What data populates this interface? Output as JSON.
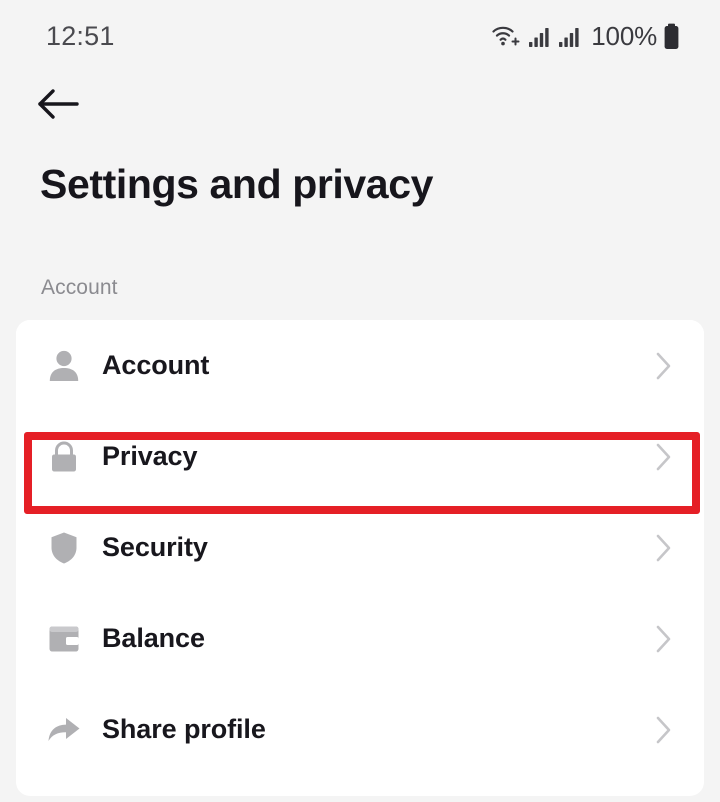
{
  "status_bar": {
    "time": "12:51",
    "battery_percent": "100%",
    "icons": [
      "wifi-calling-icon",
      "signal-bars-icon",
      "signal-bars-icon",
      "battery-icon"
    ]
  },
  "navigation": {
    "back_label": "Back",
    "back_icon": "arrow-left-icon"
  },
  "header": {
    "title": "Settings and privacy"
  },
  "sections": [
    {
      "label": "Account",
      "items": [
        {
          "label": "Account",
          "icon": "person-icon",
          "chevron": "chevron-right-icon",
          "highlighted": false
        },
        {
          "label": "Privacy",
          "icon": "lock-icon",
          "chevron": "chevron-right-icon",
          "highlighted": true
        },
        {
          "label": "Security",
          "icon": "shield-icon",
          "chevron": "chevron-right-icon",
          "highlighted": false
        },
        {
          "label": "Balance",
          "icon": "wallet-icon",
          "chevron": "chevron-right-icon",
          "highlighted": false
        },
        {
          "label": "Share profile",
          "icon": "share-arrow-icon",
          "chevron": "chevron-right-icon",
          "highlighted": false
        }
      ]
    }
  ],
  "colors": {
    "page_background": "#f4f4f4",
    "card_background": "#ffffff",
    "title_text": "#17161c",
    "section_label_text": "#8b8b90",
    "row_label_text": "#18171d",
    "row_icon": "#b0b0b3",
    "chevron": "#c6c6c9",
    "highlight_border": "#e51f26"
  }
}
